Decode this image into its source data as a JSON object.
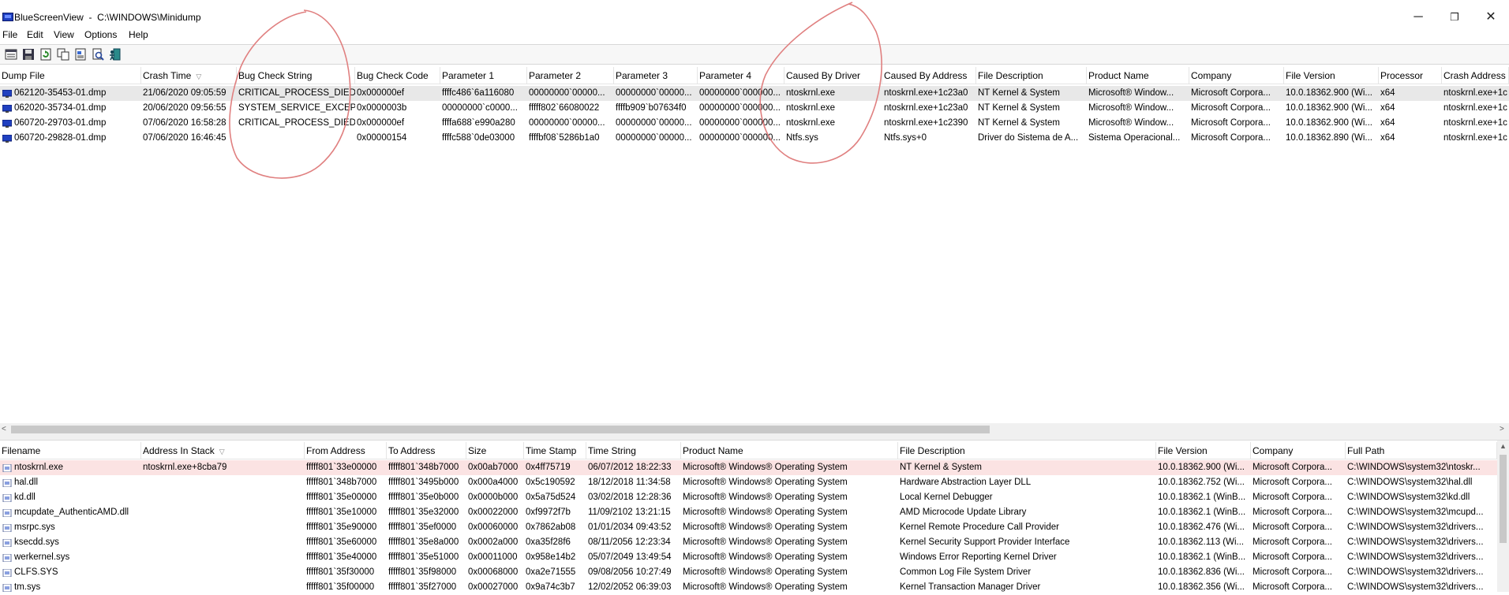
{
  "window": {
    "title": "BlueScreenView  -  C:\\WINDOWS\\Minidump",
    "minimize": "─",
    "restore": "❐",
    "close": "✕"
  },
  "menu": [
    "File",
    "Edit",
    "View",
    "Options",
    "Help"
  ],
  "toolbar": {
    "buttons": [
      "properties-icon",
      "save-icon",
      "refresh-icon",
      "copy-icon",
      "html-report-icon",
      "find-icon",
      "exit-icon"
    ]
  },
  "top_grid": {
    "columns": [
      "Dump File",
      "Crash Time",
      "Bug Check String",
      "Bug Check Code",
      "Parameter 1",
      "Parameter 2",
      "Parameter 3",
      "Parameter 4",
      "Caused By Driver",
      "Caused By Address",
      "File Description",
      "Product Name",
      "Company",
      "File Version",
      "Processor",
      "Crash Address"
    ],
    "sort_column": "Crash Time",
    "rows": [
      [
        "062120-35453-01.dmp",
        "21/06/2020 09:05:59",
        "CRITICAL_PROCESS_DIED",
        "0x000000ef",
        "ffffc486`6a116080",
        "00000000`00000...",
        "00000000`00000...",
        "00000000`000000...",
        "ntoskrnl.exe",
        "ntoskrnl.exe+1c23a0",
        "NT Kernel & System",
        "Microsoft® Window...",
        "Microsoft Corpora...",
        "10.0.18362.900 (Wi...",
        "x64",
        "ntoskrnl.exe+1c"
      ],
      [
        "062020-35734-01.dmp",
        "20/06/2020 09:56:55",
        "SYSTEM_SERVICE_EXCEP...",
        "0x0000003b",
        "00000000`c0000...",
        "fffff802`66080022",
        "ffffb909`b07634f0",
        "00000000`000000...",
        "ntoskrnl.exe",
        "ntoskrnl.exe+1c23a0",
        "NT Kernel & System",
        "Microsoft® Window...",
        "Microsoft Corpora...",
        "10.0.18362.900 (Wi...",
        "x64",
        "ntoskrnl.exe+1c"
      ],
      [
        "060720-29703-01.dmp",
        "07/06/2020 16:58:28",
        "CRITICAL_PROCESS_DIED",
        "0x000000ef",
        "ffffa688`e990a280",
        "00000000`00000...",
        "00000000`00000...",
        "00000000`000000...",
        "ntoskrnl.exe",
        "ntoskrnl.exe+1c2390",
        "NT Kernel & System",
        "Microsoft® Window...",
        "Microsoft Corpora...",
        "10.0.18362.900 (Wi...",
        "x64",
        "ntoskrnl.exe+1c"
      ],
      [
        "060720-29828-01.dmp",
        "07/06/2020 16:46:45",
        "",
        "0x00000154",
        "ffffc588`0de03000",
        "ffffbf08`5286b1a0",
        "00000000`00000...",
        "00000000`000000...",
        "Ntfs.sys",
        "Ntfs.sys+0",
        "Driver do Sistema de A...",
        "Sistema Operacional...",
        "Microsoft Corpora...",
        "10.0.18362.890 (Wi...",
        "x64",
        "ntoskrnl.exe+1c"
      ]
    ]
  },
  "bottom_grid": {
    "columns": [
      "Filename",
      "Address In Stack",
      "From Address",
      "To Address",
      "Size",
      "Time Stamp",
      "Time String",
      "Product Name",
      "File Description",
      "File Version",
      "Company",
      "Full Path"
    ],
    "sort_column": "Address In Stack",
    "rows": [
      [
        "ntoskrnl.exe",
        "ntoskrnl.exe+8cba79",
        "fffff801`33e00000",
        "fffff801`348b7000",
        "0x00ab7000",
        "0x4ff75719",
        "06/07/2012 18:22:33",
        "Microsoft® Windows® Operating System",
        "NT Kernel & System",
        "10.0.18362.900 (Wi...",
        "Microsoft Corpora...",
        "C:\\WINDOWS\\system32\\ntoskr..."
      ],
      [
        "hal.dll",
        "",
        "fffff801`348b7000",
        "fffff801`3495b000",
        "0x000a4000",
        "0x5c190592",
        "18/12/2018 11:34:58",
        "Microsoft® Windows® Operating System",
        "Hardware Abstraction Layer DLL",
        "10.0.18362.752 (Wi...",
        "Microsoft Corpora...",
        "C:\\WINDOWS\\system32\\hal.dll"
      ],
      [
        "kd.dll",
        "",
        "fffff801`35e00000",
        "fffff801`35e0b000",
        "0x0000b000",
        "0x5a75d524",
        "03/02/2018 12:28:36",
        "Microsoft® Windows® Operating System",
        "Local Kernel Debugger",
        "10.0.18362.1 (WinB...",
        "Microsoft Corpora...",
        "C:\\WINDOWS\\system32\\kd.dll"
      ],
      [
        "mcupdate_AuthenticAMD.dll",
        "",
        "fffff801`35e10000",
        "fffff801`35e32000",
        "0x00022000",
        "0xf9972f7b",
        "11/09/2102 13:21:15",
        "Microsoft® Windows® Operating System",
        "AMD Microcode Update Library",
        "10.0.18362.1 (WinB...",
        "Microsoft Corpora...",
        "C:\\WINDOWS\\system32\\mcupd..."
      ],
      [
        "msrpc.sys",
        "",
        "fffff801`35e90000",
        "fffff801`35ef0000",
        "0x00060000",
        "0x7862ab08",
        "01/01/2034 09:43:52",
        "Microsoft® Windows® Operating System",
        "Kernel Remote Procedure Call Provider",
        "10.0.18362.476 (Wi...",
        "Microsoft Corpora...",
        "C:\\WINDOWS\\system32\\drivers..."
      ],
      [
        "ksecdd.sys",
        "",
        "fffff801`35e60000",
        "fffff801`35e8a000",
        "0x0002a000",
        "0xa35f28f6",
        "08/11/2056 12:23:34",
        "Microsoft® Windows® Operating System",
        "Kernel Security Support Provider Interface",
        "10.0.18362.113 (Wi...",
        "Microsoft Corpora...",
        "C:\\WINDOWS\\system32\\drivers..."
      ],
      [
        "werkernel.sys",
        "",
        "fffff801`35e40000",
        "fffff801`35e51000",
        "0x00011000",
        "0x958e14b2",
        "05/07/2049 13:49:54",
        "Microsoft® Windows® Operating System",
        "Windows Error Reporting Kernel Driver",
        "10.0.18362.1 (WinB...",
        "Microsoft Corpora...",
        "C:\\WINDOWS\\system32\\drivers..."
      ],
      [
        "CLFS.SYS",
        "",
        "fffff801`35f30000",
        "fffff801`35f98000",
        "0x00068000",
        "0xa2e71555",
        "09/08/2056 10:27:49",
        "Microsoft® Windows® Operating System",
        "Common Log File System Driver",
        "10.0.18362.836 (Wi...",
        "Microsoft Corpora...",
        "C:\\WINDOWS\\system32\\drivers..."
      ],
      [
        "tm.sys",
        "",
        "fffff801`35f00000",
        "fffff801`35f27000",
        "0x00027000",
        "0x9a74c3b7",
        "12/02/2052 06:39:03",
        "Microsoft® Windows® Operating System",
        "Kernel Transaction Manager Driver",
        "10.0.18362.356 (Wi...",
        "Microsoft Corpora...",
        "C:\\WINDOWS\\system32\\drivers..."
      ]
    ]
  },
  "colors": {
    "selected_row": "#e8e8e8",
    "highlighted_row": "#fbe3e3",
    "annotation": "#e08080"
  }
}
